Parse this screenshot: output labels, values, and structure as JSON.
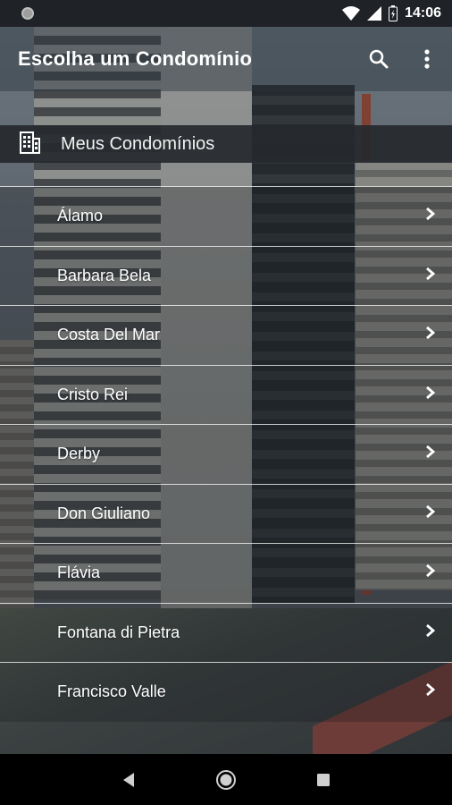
{
  "status_bar": {
    "time": "14:06",
    "icons": [
      "notification-dot-icon",
      "wifi-icon",
      "signal-icon",
      "battery-icon"
    ]
  },
  "app_bar": {
    "title": "Escolha um Condomínio",
    "actions": [
      "search-icon",
      "more-vertical-icon"
    ]
  },
  "section": {
    "icon": "building-icon",
    "label": "Meus Condomínios"
  },
  "condominios": [
    {
      "name": "Álamo"
    },
    {
      "name": "Barbara Bela"
    },
    {
      "name": "Costa Del Mar"
    },
    {
      "name": "Cristo Rei"
    },
    {
      "name": "Derby"
    },
    {
      "name": "Don Giuliano"
    },
    {
      "name": "Flávia"
    },
    {
      "name": "Fontana di Pietra"
    },
    {
      "name": "Francisco Valle"
    }
  ],
  "nav_bar": {
    "buttons": [
      "back-icon",
      "home-icon",
      "recents-icon"
    ]
  },
  "colors": {
    "status_bar_bg": "#1f2226",
    "section_header_bg": "#26292d",
    "nav_bar_bg": "#000000",
    "text": "#ffffff"
  }
}
